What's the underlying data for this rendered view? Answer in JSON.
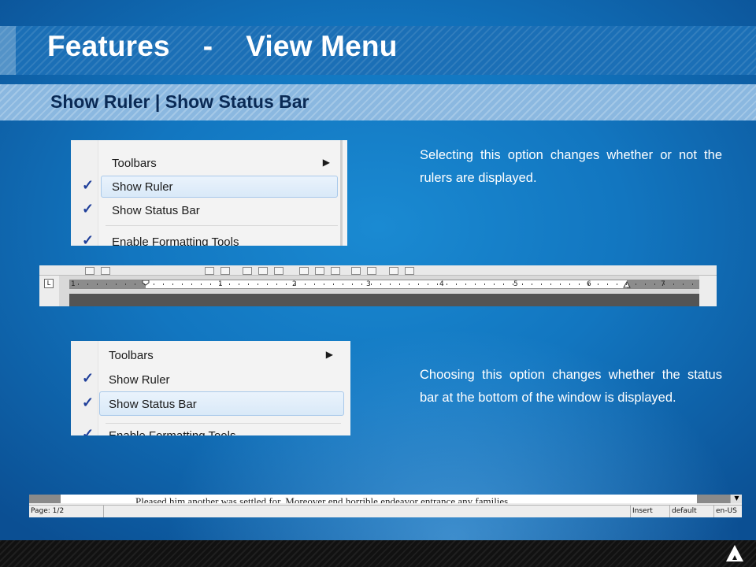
{
  "slide": {
    "title": "Features    -    View Menu",
    "subtitle": "Show Ruler | Show Status Bar"
  },
  "section1": {
    "description": "Selecting this option changes whether or not the rulers are displayed.",
    "menu": {
      "items": [
        {
          "label": "Toolbars",
          "submenu": true,
          "checked": false
        },
        {
          "label": "Show Ruler",
          "checked": true,
          "highlighted": true
        },
        {
          "label": "Show Status Bar",
          "checked": true
        },
        {
          "label": "Enable Formatting Tools",
          "checked": true
        }
      ]
    },
    "ruler": {
      "numbers": [
        "1",
        "1",
        "2",
        "3",
        "4",
        "5",
        "6",
        "7"
      ],
      "corner_glyph": "L"
    }
  },
  "section2": {
    "description": "Choosing this option changes whether the status bar at the bottom of the window is displayed.",
    "menu": {
      "items": [
        {
          "label": "Toolbars",
          "submenu": true,
          "checked": false
        },
        {
          "label": "Show Ruler",
          "checked": true
        },
        {
          "label": "Show Status Bar",
          "checked": true,
          "highlighted": true
        },
        {
          "label": "Enable Formatting Tools",
          "checked": true
        }
      ]
    },
    "statusbar": {
      "doc_text": "Pleased him another was settled for. Moreover end horrible endeavor entrance any families.",
      "page": "Page: 1/2",
      "mode": "Insert",
      "style": "default",
      "language": "en-US"
    }
  },
  "icons": {
    "check": "✓",
    "submenu_arrow": "▶",
    "scroll_down": "▼"
  },
  "colors": {
    "background": "#1276c0",
    "title_band": "#1b6fb6",
    "subtitle_band": "#8bb8e0",
    "subtitle_text": "#0a2a55"
  }
}
